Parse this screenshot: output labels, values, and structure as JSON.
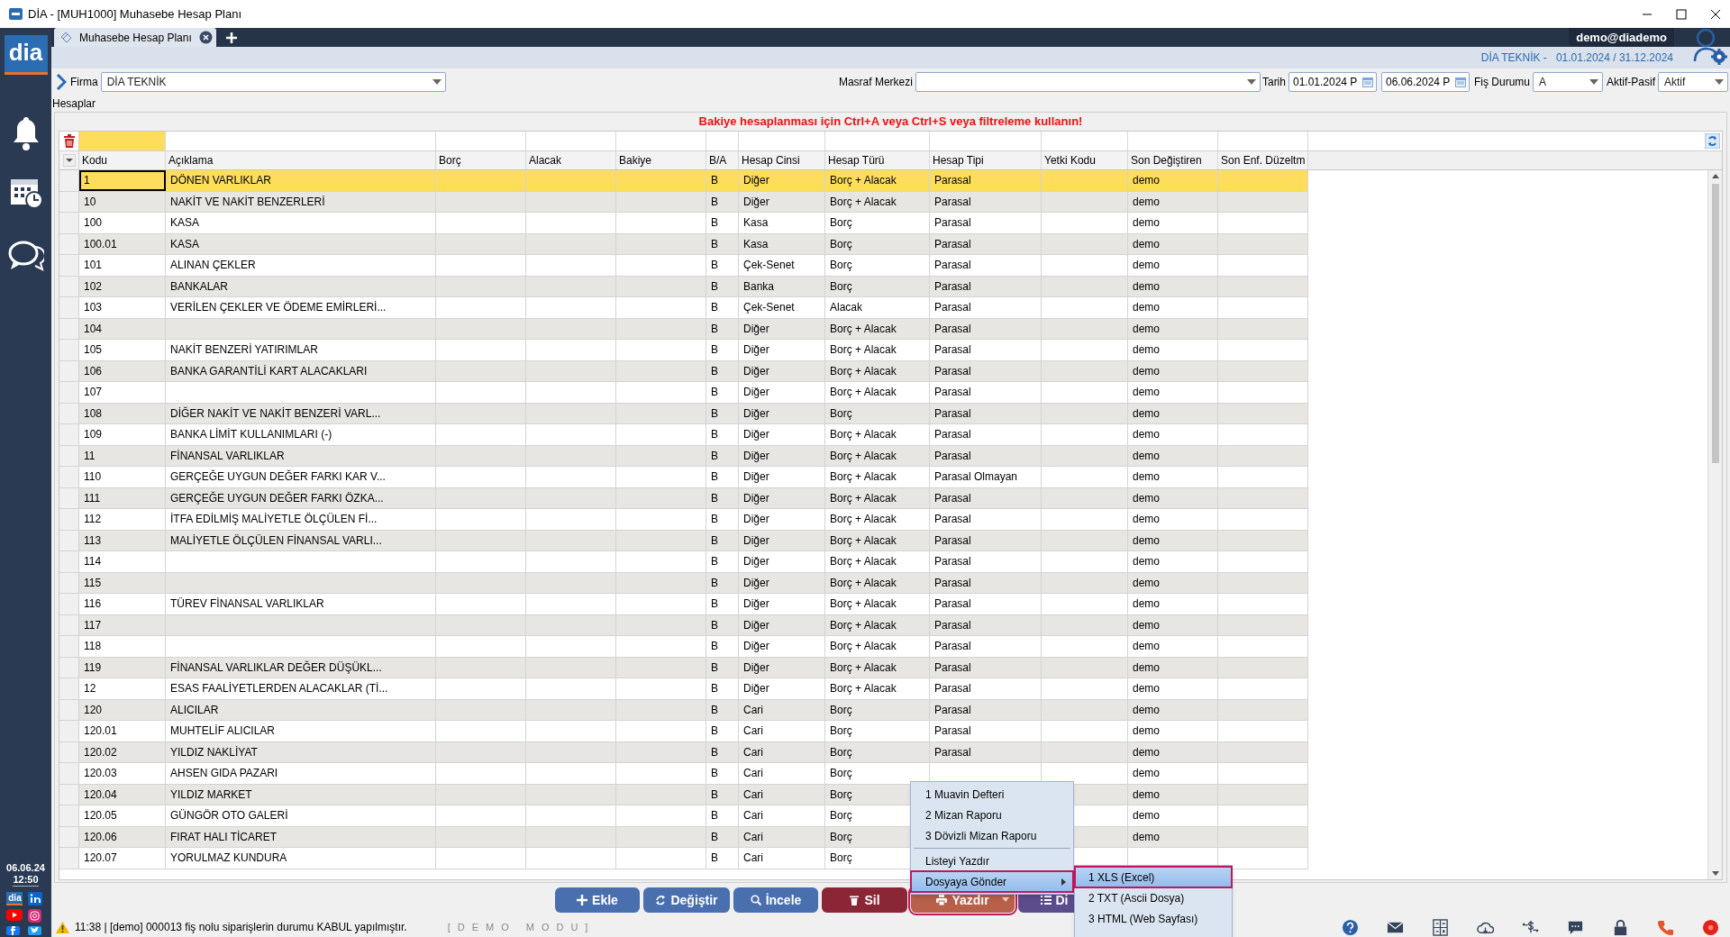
{
  "window": {
    "title": "DİA - [MUH1000] Muhasebe Hesap Planı"
  },
  "sidebar": {
    "logo": "dia",
    "date": "06.06.24",
    "time": "12:50",
    "social_logo": "dia"
  },
  "tabs": [
    {
      "label": "Muhasebe Hesap Planı",
      "selected": true
    }
  ],
  "user": "demo@diademo",
  "period": {
    "company": "DİA TEKNİK -",
    "range": "01.01.2024 / 31.12.2024"
  },
  "filters": {
    "firma_label": "Firma",
    "firma": "DİA TEKNİK",
    "masraf_label": "Masraf Merkezi",
    "tarih_label": "Tarih",
    "date_from": "01.01.2024 P",
    "date_to": "06.06.2024 P",
    "fis_label": "Fiş Durumu",
    "fis": "A",
    "aktif_label": "Aktif-Pasif",
    "aktif": "Aktif"
  },
  "section_title": "Hesaplar",
  "notice": "Bakiye hesaplanması için Ctrl+A veya Ctrl+S veya filtreleme kullanın!",
  "table": {
    "columns": [
      "Kodu",
      "Açıklama",
      "Borç",
      "Alacak",
      "Bakiye",
      "B/A",
      "Hesap Cinsi",
      "Hesap Türü",
      "Hesap Tipi",
      "Yetki Kodu",
      "Son Değiştiren",
      "Son Enf. Düzeltm"
    ],
    "rows": [
      {
        "kodu": "1",
        "aciklama": "DÖNEN VARLIKLAR",
        "ba": "B",
        "cinsi": "Diğer",
        "turu": "Borç + Alacak",
        "tipi": "Parasal",
        "son": "demo",
        "selected": true
      },
      {
        "kodu": "10",
        "aciklama": "NAKİT VE NAKİT BENZERLERİ",
        "ba": "B",
        "cinsi": "Diğer",
        "turu": "Borç + Alacak",
        "tipi": "Parasal",
        "son": "demo",
        "selected": false
      },
      {
        "kodu": "100",
        "aciklama": "KASA",
        "ba": "B",
        "cinsi": "Kasa",
        "turu": "Borç",
        "tipi": "Parasal",
        "son": "demo",
        "selected": false
      },
      {
        "kodu": "100.01",
        "aciklama": "KASA",
        "ba": "B",
        "cinsi": "Kasa",
        "turu": "Borç",
        "tipi": "Parasal",
        "son": "demo",
        "selected": false
      },
      {
        "kodu": "101",
        "aciklama": "ALINAN ÇEKLER",
        "ba": "B",
        "cinsi": "Çek-Senet",
        "turu": "Borç",
        "tipi": "Parasal",
        "son": "demo",
        "selected": false
      },
      {
        "kodu": "102",
        "aciklama": "BANKALAR",
        "ba": "B",
        "cinsi": "Banka",
        "turu": "Borç",
        "tipi": "Parasal",
        "son": "demo",
        "selected": false
      },
      {
        "kodu": "103",
        "aciklama": "VERİLEN ÇEKLER VE ÖDEME EMİRLERİ...",
        "ba": "B",
        "cinsi": "Çek-Senet",
        "turu": "Alacak",
        "tipi": "Parasal",
        "son": "demo",
        "selected": false
      },
      {
        "kodu": "104",
        "ba": "B",
        "cinsi": "Diğer",
        "turu": "Borç + Alacak",
        "tipi": "Parasal",
        "son": "demo",
        "selected": false
      },
      {
        "kodu": "105",
        "aciklama": "NAKİT BENZERİ YATIRIMLAR",
        "ba": "B",
        "cinsi": "Diğer",
        "turu": "Borç + Alacak",
        "tipi": "Parasal",
        "son": "demo",
        "selected": false
      },
      {
        "kodu": "106",
        "aciklama": "BANKA GARANTİLİ KART ALACAKLARI",
        "ba": "B",
        "cinsi": "Diğer",
        "turu": "Borç + Alacak",
        "tipi": "Parasal",
        "son": "demo",
        "selected": false
      },
      {
        "kodu": "107",
        "ba": "B",
        "cinsi": "Diğer",
        "turu": "Borç + Alacak",
        "tipi": "Parasal",
        "son": "demo",
        "selected": false
      },
      {
        "kodu": "108",
        "aciklama": "DİĞER NAKİT VE NAKİT BENZERİ VARL...",
        "ba": "B",
        "cinsi": "Diğer",
        "turu": "Borç",
        "tipi": "Parasal",
        "son": "demo",
        "selected": false
      },
      {
        "kodu": "109",
        "aciklama": "BANKA LİMİT KULLANIMLARI (-)",
        "ba": "B",
        "cinsi": "Diğer",
        "turu": "Borç + Alacak",
        "tipi": "Parasal",
        "son": "demo",
        "selected": false
      },
      {
        "kodu": "11",
        "aciklama": "FİNANSAL VARLIKLAR",
        "ba": "B",
        "cinsi": "Diğer",
        "turu": "Borç + Alacak",
        "tipi": "Parasal",
        "son": "demo",
        "selected": false
      },
      {
        "kodu": "110",
        "aciklama": "GERÇEĞE UYGUN DEĞER FARKI KAR V...",
        "ba": "B",
        "cinsi": "Diğer",
        "turu": "Borç + Alacak",
        "tipi": "Parasal Olmayan",
        "son": "demo",
        "selected": false
      },
      {
        "kodu": "111",
        "aciklama": "GERÇEĞE UYGUN DEĞER FARKI ÖZKA...",
        "ba": "B",
        "cinsi": "Diğer",
        "turu": "Borç + Alacak",
        "tipi": "Parasal",
        "son": "demo",
        "selected": false
      },
      {
        "kodu": "112",
        "aciklama": "İTFA EDİLMİŞ MALİYETLE ÖLÇÜLEN Fİ...",
        "ba": "B",
        "cinsi": "Diğer",
        "turu": "Borç + Alacak",
        "tipi": "Parasal",
        "son": "demo",
        "selected": false
      },
      {
        "kodu": "113",
        "aciklama": "MALİYETLE ÖLÇÜLEN FİNANSAL VARLI...",
        "ba": "B",
        "cinsi": "Diğer",
        "turu": "Borç + Alacak",
        "tipi": "Parasal",
        "son": "demo",
        "selected": false
      },
      {
        "kodu": "114",
        "ba": "B",
        "cinsi": "Diğer",
        "turu": "Borç + Alacak",
        "tipi": "Parasal",
        "son": "demo",
        "selected": false
      },
      {
        "kodu": "115",
        "ba": "B",
        "cinsi": "Diğer",
        "turu": "Borç + Alacak",
        "tipi": "Parasal",
        "son": "demo",
        "selected": false
      },
      {
        "kodu": "116",
        "aciklama": "TÜREV FİNANSAL VARLIKLAR",
        "ba": "B",
        "cinsi": "Diğer",
        "turu": "Borç + Alacak",
        "tipi": "Parasal",
        "son": "demo",
        "selected": false
      },
      {
        "kodu": "117",
        "ba": "B",
        "cinsi": "Diğer",
        "turu": "Borç + Alacak",
        "tipi": "Parasal",
        "son": "demo",
        "selected": false
      },
      {
        "kodu": "118",
        "ba": "B",
        "cinsi": "Diğer",
        "turu": "Borç + Alacak",
        "tipi": "Parasal",
        "son": "demo",
        "selected": false
      },
      {
        "kodu": "119",
        "aciklama": "FİNANSAL VARLIKLAR DEĞER DÜŞÜKL...",
        "ba": "B",
        "cinsi": "Diğer",
        "turu": "Borç + Alacak",
        "tipi": "Parasal",
        "son": "demo",
        "selected": false
      },
      {
        "kodu": "12",
        "aciklama": "ESAS FAALİYETLERDEN ALACAKLAR (Tİ...",
        "ba": "B",
        "cinsi": "Diğer",
        "turu": "Borç + Alacak",
        "tipi": "Parasal",
        "son": "demo",
        "selected": false
      },
      {
        "kodu": "120",
        "aciklama": "ALICILAR",
        "ba": "B",
        "cinsi": "Cari",
        "turu": "Borç",
        "tipi": "Parasal",
        "son": "demo",
        "selected": false
      },
      {
        "kodu": "120.01",
        "aciklama": "MUHTELİF ALICILAR",
        "ba": "B",
        "cinsi": "Cari",
        "turu": "Borç",
        "tipi": "Parasal",
        "son": "demo",
        "selected": false
      },
      {
        "kodu": "120.02",
        "aciklama": "YILDIZ NAKLİYAT",
        "ba": "B",
        "cinsi": "Cari",
        "turu": "Borç",
        "tipi": "Parasal",
        "son": "demo",
        "selected": false
      },
      {
        "kodu": "120.03",
        "aciklama": "AHSEN GIDA PAZARI",
        "ba": "B",
        "cinsi": "Cari",
        "turu": "Borç",
        "son": "demo",
        "selected": false
      },
      {
        "kodu": "120.04",
        "aciklama": "YILDIZ MARKET",
        "ba": "B",
        "cinsi": "Cari",
        "turu": "Borç",
        "son": "demo",
        "selected": false
      },
      {
        "kodu": "120.05",
        "aciklama": "GÜNGÖR OTO GALERİ",
        "ba": "B",
        "cinsi": "Cari",
        "turu": "Borç",
        "son": "demo",
        "selected": false
      },
      {
        "kodu": "120.06",
        "aciklama": "FIRAT HALI TİCARET",
        "ba": "B",
        "cinsi": "Cari",
        "turu": "Borç",
        "son": "demo",
        "selected": false
      },
      {
        "kodu": "120.07",
        "aciklama": "YORULMAZ KUNDURA",
        "ba": "B",
        "cinsi": "Cari",
        "turu": "Borç",
        "selected": false
      }
    ]
  },
  "buttons": [
    {
      "label": "Ekle",
      "kind": "add",
      "color": "#4a6fae",
      "highlighted": false
    },
    {
      "label": "Değiştir",
      "kind": "edit",
      "color": "#4a6fae",
      "highlighted": false
    },
    {
      "label": "İncele",
      "kind": "view",
      "color": "#4a6fae",
      "highlighted": false
    },
    {
      "label": "Sil",
      "kind": "delete",
      "color": "#8b2636",
      "highlighted": false
    },
    {
      "label": "Yazdır",
      "kind": "print",
      "color": "#b8604a",
      "highlighted": true
    },
    {
      "label": "Di",
      "kind": "list",
      "color": "#5d4c8c",
      "highlighted": false
    }
  ],
  "print_menu": [
    {
      "kind": "item",
      "label": "1 Muavin Defteri",
      "selected": false,
      "submenu": false
    },
    {
      "kind": "item",
      "label": "2 Mizan Raporu",
      "selected": false,
      "submenu": false
    },
    {
      "kind": "item",
      "label": "3 Dövizli Mizan Raporu",
      "selected": false,
      "submenu": false
    },
    {
      "kind": "separator"
    },
    {
      "kind": "item",
      "label": "Listeyi Yazdır",
      "selected": false,
      "submenu": false
    },
    {
      "kind": "item",
      "label": "Dosyaya Gönder",
      "selected": true,
      "submenu": true
    }
  ],
  "export_menu": [
    {
      "label": "1 XLS (Excel)",
      "selected": true
    },
    {
      "label": "2 TXT (Ascii Dosya)",
      "selected": false
    },
    {
      "label": "3 HTML (Web Sayfası)",
      "selected": false
    }
  ],
  "status": {
    "message": "11:38 | [demo] 000013 fiş nolu siparişlerin durumu KABUL yapılmıştır.",
    "mode": "[DEMO MODU]"
  }
}
